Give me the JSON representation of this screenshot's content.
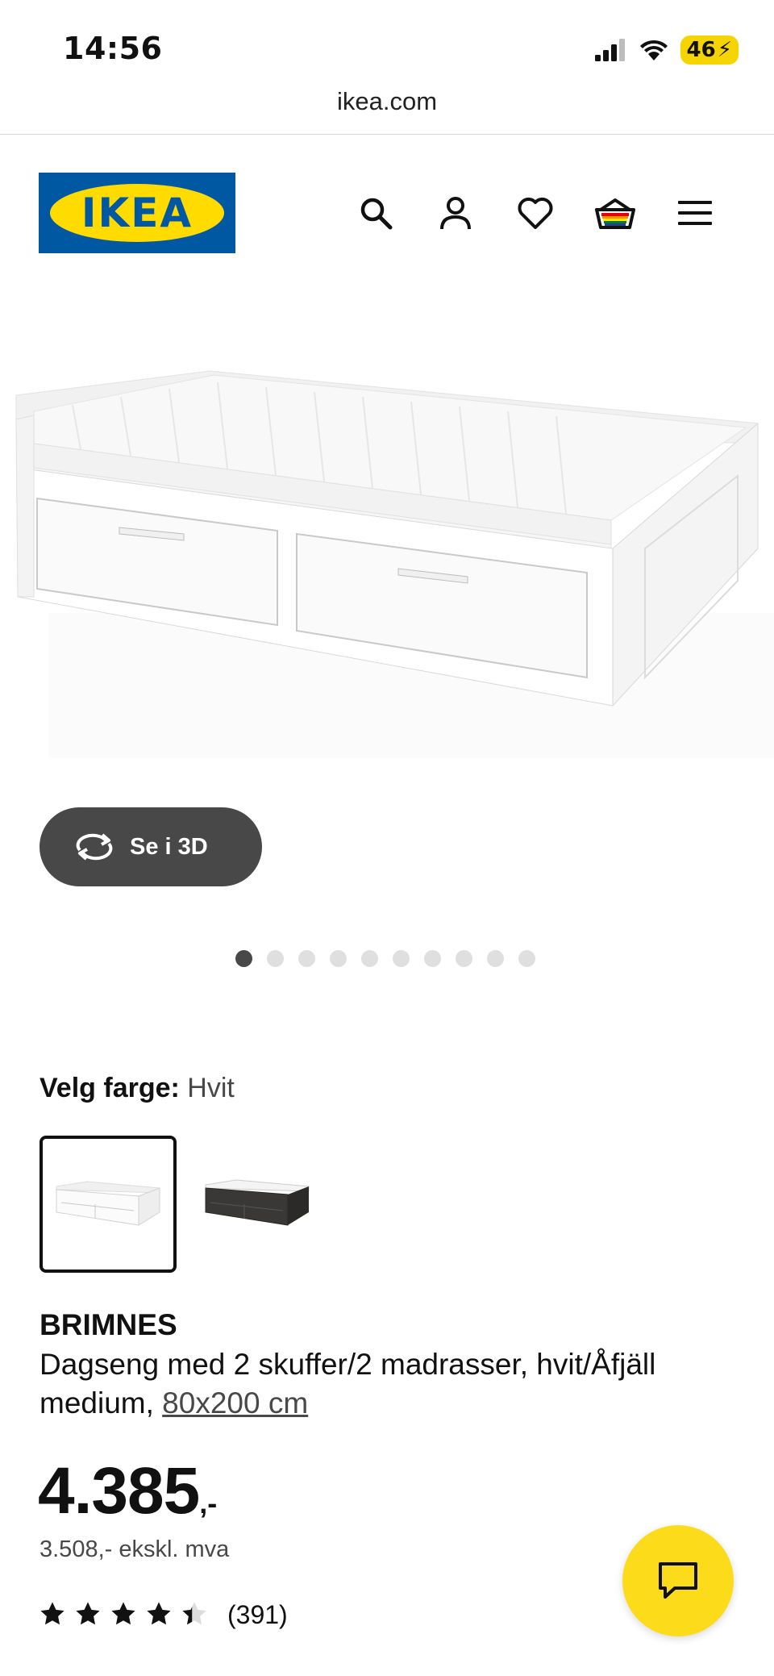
{
  "status_bar": {
    "time": "14:56",
    "battery": "46"
  },
  "browser": {
    "url": "ikea.com"
  },
  "header": {
    "logo_text": "IKEA",
    "icons": [
      "search-icon",
      "account-icon",
      "heart-icon",
      "basket-icon",
      "menu-icon"
    ]
  },
  "gallery": {
    "view_3d_label": "Se i 3D",
    "image_count": 10,
    "active_index": 0
  },
  "color_picker": {
    "label": "Velg farge:",
    "selected": "Hvit",
    "options": [
      "Hvit",
      "Svart-brun"
    ]
  },
  "product": {
    "name": "BRIMNES",
    "description": "Dagseng med 2 skuffer/2 madrasser, hvit/Åfjäll medium,",
    "size_link": "80x200 cm",
    "price": "4.385",
    "price_suffix": ",-",
    "price_ex_vat": "3.508,- ekskl. mva",
    "rating": 4.4,
    "review_count": "(391)"
  },
  "colors": {
    "accent": "#fcdb1b",
    "brand_blue": "#0058a3",
    "dark_gray": "#484848"
  }
}
